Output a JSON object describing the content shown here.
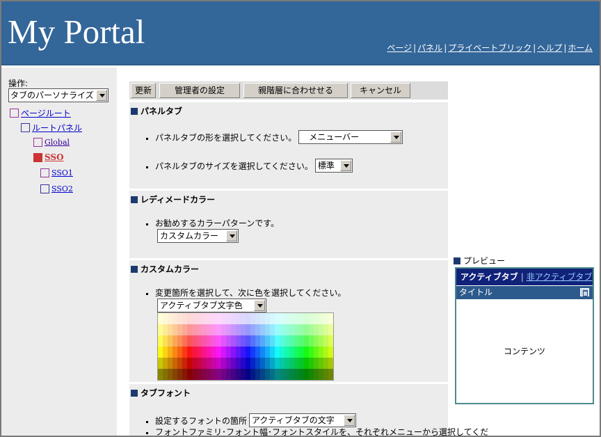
{
  "header": {
    "title": "My Portal",
    "nav": [
      "ページ",
      "パネル",
      "プライベートブリック",
      "ヘルプ",
      "ホーム"
    ],
    "bg_color": "#336699"
  },
  "sidebar": {
    "operation_label": "操作:",
    "operation_selected": "タブのパーソナライズ",
    "tree": [
      {
        "label": "ページルート"
      },
      {
        "label": "ルートパネル"
      },
      {
        "label": "Global"
      },
      {
        "label": "SSO",
        "selected": true
      },
      {
        "label": "SSO1"
      },
      {
        "label": "SSO2"
      }
    ]
  },
  "toolbar": {
    "update": "更新",
    "admin": "管理者の設定",
    "parent": "親階層に合わせせる",
    "cancel": "キャンセル"
  },
  "panel_tab": {
    "title": "パネルタブ",
    "shape_label": "パネルタブの形を選択してください。",
    "shape_value": "メニューバー",
    "size_label": "パネルタブのサイズを選択してください。",
    "size_value": "標準"
  },
  "ready_color": {
    "title": "レディメードカラー",
    "label": "お勧めするカラーパターンです。",
    "value": "カスタムカラー"
  },
  "custom_color": {
    "title": "カスタムカラー",
    "label": "変更箇所を選択して、次に色を選択してください。",
    "value": "アクティブタブ文字色"
  },
  "tab_font": {
    "title": "タブフォント",
    "target_label": "設定するフォントの箇所",
    "target_value": "アクティブタブの文字",
    "desc": "フォントファミリ･フォント幅･フォントスタイルを、それぞれメニューから選択してくだ"
  },
  "preview": {
    "label": "プレビュー",
    "active_tab": "アクティブタブ",
    "inactive_tab": "非アクティブタブ",
    "title": "タイトル",
    "content": "コンテンツ"
  }
}
